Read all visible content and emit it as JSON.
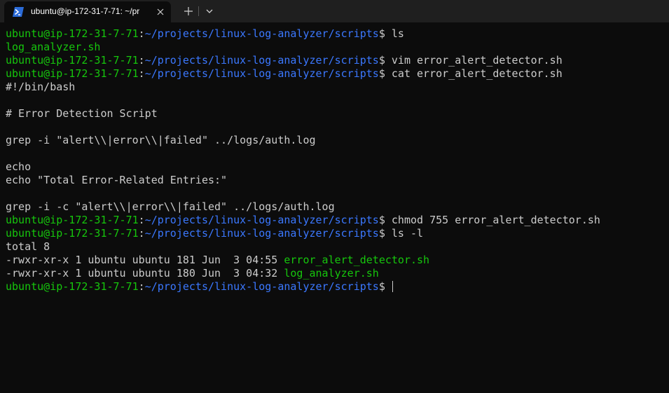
{
  "tab": {
    "title": "ubuntu@ip-172-31-7-71: ~/pr",
    "icon": "powershell-icon",
    "close_icon": "close-icon"
  },
  "titlebar": {
    "new_tab_icon": "plus-icon",
    "dropdown_icon": "chevron-down-icon"
  },
  "colors": {
    "background": "#0c0c0c",
    "text": "#cccccc",
    "prompt_user": "#16c60c",
    "prompt_path": "#3b78ff",
    "executable": "#16c60c"
  },
  "terminal": {
    "prompt_user": "ubuntu@ip-172-31-7-71",
    "prompt_sep": ":",
    "prompt_path": "~/projects/linux-log-analyzer/scripts",
    "prompt_sym": "$ ",
    "lines": [
      {
        "type": "prompt",
        "cmd": "ls"
      },
      {
        "type": "exec",
        "text": "log_analyzer.sh"
      },
      {
        "type": "prompt",
        "cmd": "vim error_alert_detector.sh"
      },
      {
        "type": "prompt",
        "cmd": "cat error_alert_detector.sh"
      },
      {
        "type": "out",
        "text": "#!/bin/bash"
      },
      {
        "type": "out",
        "text": ""
      },
      {
        "type": "out",
        "text": "# Error Detection Script"
      },
      {
        "type": "out",
        "text": ""
      },
      {
        "type": "out",
        "text": "grep -i \"alert\\\\|error\\\\|failed\" ../logs/auth.log"
      },
      {
        "type": "out",
        "text": ""
      },
      {
        "type": "out",
        "text": "echo"
      },
      {
        "type": "out",
        "text": "echo \"Total Error-Related Entries:\""
      },
      {
        "type": "out",
        "text": ""
      },
      {
        "type": "out",
        "text": "grep -i -c \"alert\\\\|error\\\\|failed\" ../logs/auth.log"
      },
      {
        "type": "prompt",
        "cmd": "chmod 755 error_alert_detector.sh"
      },
      {
        "type": "prompt",
        "cmd": "ls -l"
      },
      {
        "type": "out",
        "text": "total 8"
      },
      {
        "type": "file",
        "text": "-rwxr-xr-x 1 ubuntu ubuntu 181 Jun  3 04:55 ",
        "name": "error_alert_detector.sh"
      },
      {
        "type": "file",
        "text": "-rwxr-xr-x 1 ubuntu ubuntu 180 Jun  3 04:32 ",
        "name": "log_analyzer.sh"
      },
      {
        "type": "prompt",
        "cmd": "",
        "cursor": true
      }
    ]
  }
}
